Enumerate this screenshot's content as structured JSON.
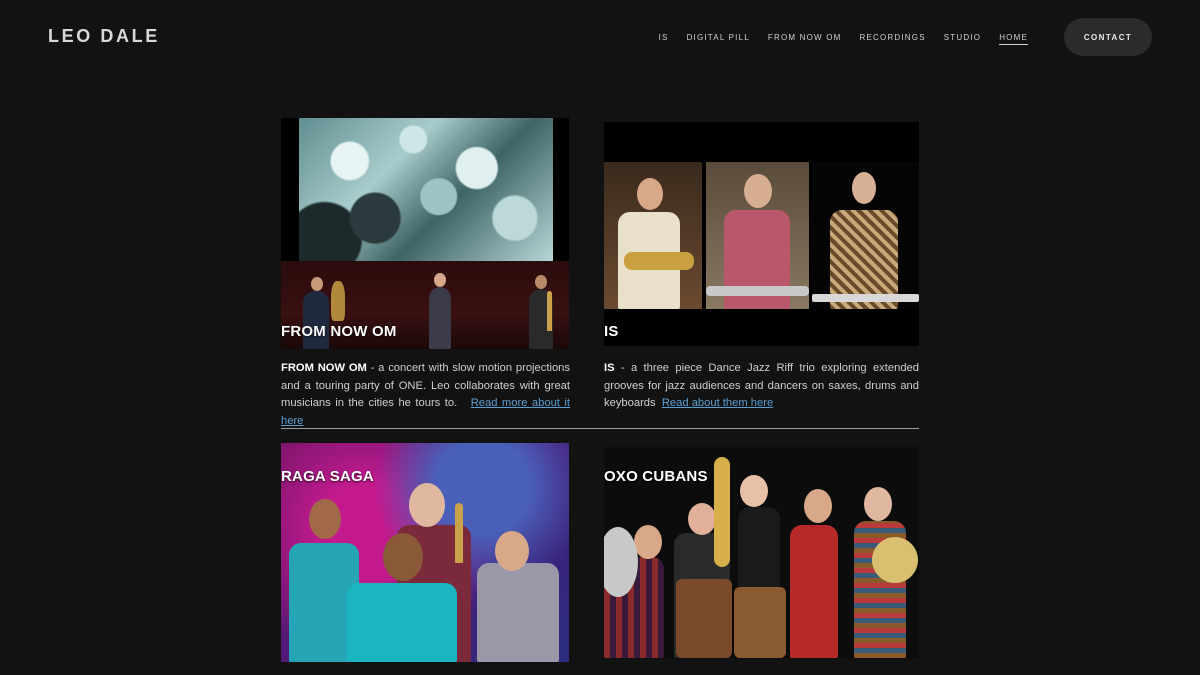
{
  "site": {
    "logo": "LEO DALE"
  },
  "nav": {
    "items": [
      {
        "label": "IS",
        "active": false
      },
      {
        "label": "DIGITAL PILL",
        "active": false
      },
      {
        "label": "FROM NOW OM",
        "active": false
      },
      {
        "label": "RECORDINGS",
        "active": false
      },
      {
        "label": "STUDIO",
        "active": false
      },
      {
        "label": "HOME",
        "active": true
      }
    ],
    "contact_label": "CONTACT"
  },
  "projects": [
    {
      "title": "FROM NOW OM",
      "desc_strong": "FROM NOW OM",
      "desc_text": " - a concert with slow motion projections and a touring party of ONE. Leo collaborates with great musicians in the cities he tours to.",
      "link": "Read more about it here"
    },
    {
      "title": "IS",
      "desc_strong": "IS",
      "desc_text": " - a three piece Dance Jazz Riff trio exploring extended grooves for jazz audiences and dancers on saxes, drums and keyboards",
      "link": "Read about them here"
    },
    {
      "title": "RAGA SAGA"
    },
    {
      "title": "OXO CUBANS"
    }
  ],
  "colors": {
    "background": "#121212",
    "link": "#5a9fd4",
    "contact_button": "#2b2b2b"
  }
}
